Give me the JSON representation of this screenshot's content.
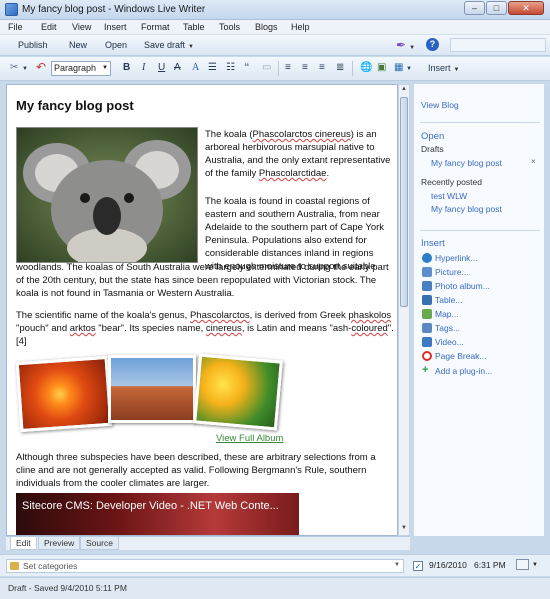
{
  "window": {
    "title": "My fancy blog post - Windows Live Writer"
  },
  "menu": [
    "File",
    "Edit",
    "View",
    "Insert",
    "Format",
    "Table",
    "Tools",
    "Blogs",
    "Help"
  ],
  "toolbar": {
    "publish": "Publish",
    "new": "New",
    "open": "Open",
    "save_draft": "Save draft"
  },
  "format_toolbar": {
    "paragraph_style": "Paragraph",
    "bold": "B",
    "italic": "I",
    "underline": "U",
    "strike": "A",
    "font_color": "A",
    "insert": "Insert"
  },
  "post": {
    "title": "My fancy blog post",
    "p1_parts": [
      "The koala (",
      "Phascolarctos cinereus",
      ") is an arboreal herbivorous marsupial native to Australia, and the only extant representative of the family ",
      "Phascolarctidae",
      "."
    ],
    "p1b": "The koala is found in coastal regions of eastern and southern Australia, from near Adelaide to the southern part of Cape York Peninsula. Populations also extend for considerable distances inland in regions with enough moisture to support suitable",
    "p1c": "woodlands. The koalas of South Australia were largely exterminated during the early part of the 20th century, but the state has since been repopulated with Victorian stock. The koala is not found in Tasmania or Western Australia.",
    "p2_parts": [
      "The scientific name of the koala's genus, ",
      "Phascolarctos",
      ", is derived from Greek ",
      "phaskolos",
      " \"pouch\" and ",
      "arktos",
      " \"bear\". Its species name, ",
      "cinereus",
      ", is Latin and means \"ash-",
      "coloured",
      "\".[4]"
    ],
    "album_link": "View Full Album",
    "p3": "Although three subspecies have been described, these are arbitrary selections from a cline and are not generally accepted as valid. Following Bergmann's Rule, southern individuals from the cooler climates are larger.",
    "video_title": "Sitecore CMS: Developer Video - .NET Web Conte..."
  },
  "sidebar": {
    "view_blog": "View Blog",
    "open": "Open",
    "drafts_label": "Drafts",
    "draft_item": "My fancy blog post",
    "remove_icon": "×",
    "recent_label": "Recently posted",
    "recent_items": [
      "test WLW",
      "My fancy blog post"
    ],
    "insert_label": "Insert",
    "insert_items": [
      "Hyperlink...",
      "Picture...",
      "Photo album...",
      "Table...",
      "Map...",
      "Tags...",
      "Video...",
      "Page Break...",
      "Add a plug-in..."
    ]
  },
  "tabs": [
    "Edit",
    "Preview",
    "Source"
  ],
  "bottom": {
    "categories_placeholder": "Set categories",
    "date": "9/16/2010",
    "time": "6:31 PM",
    "publish_date_checked": true
  },
  "status": "Draft - Saved 9/4/2010 5:11 PM",
  "colors": {
    "link": "#3a6cc0",
    "album_link": "#3a8a3a",
    "spell_underline": "#d24040"
  }
}
